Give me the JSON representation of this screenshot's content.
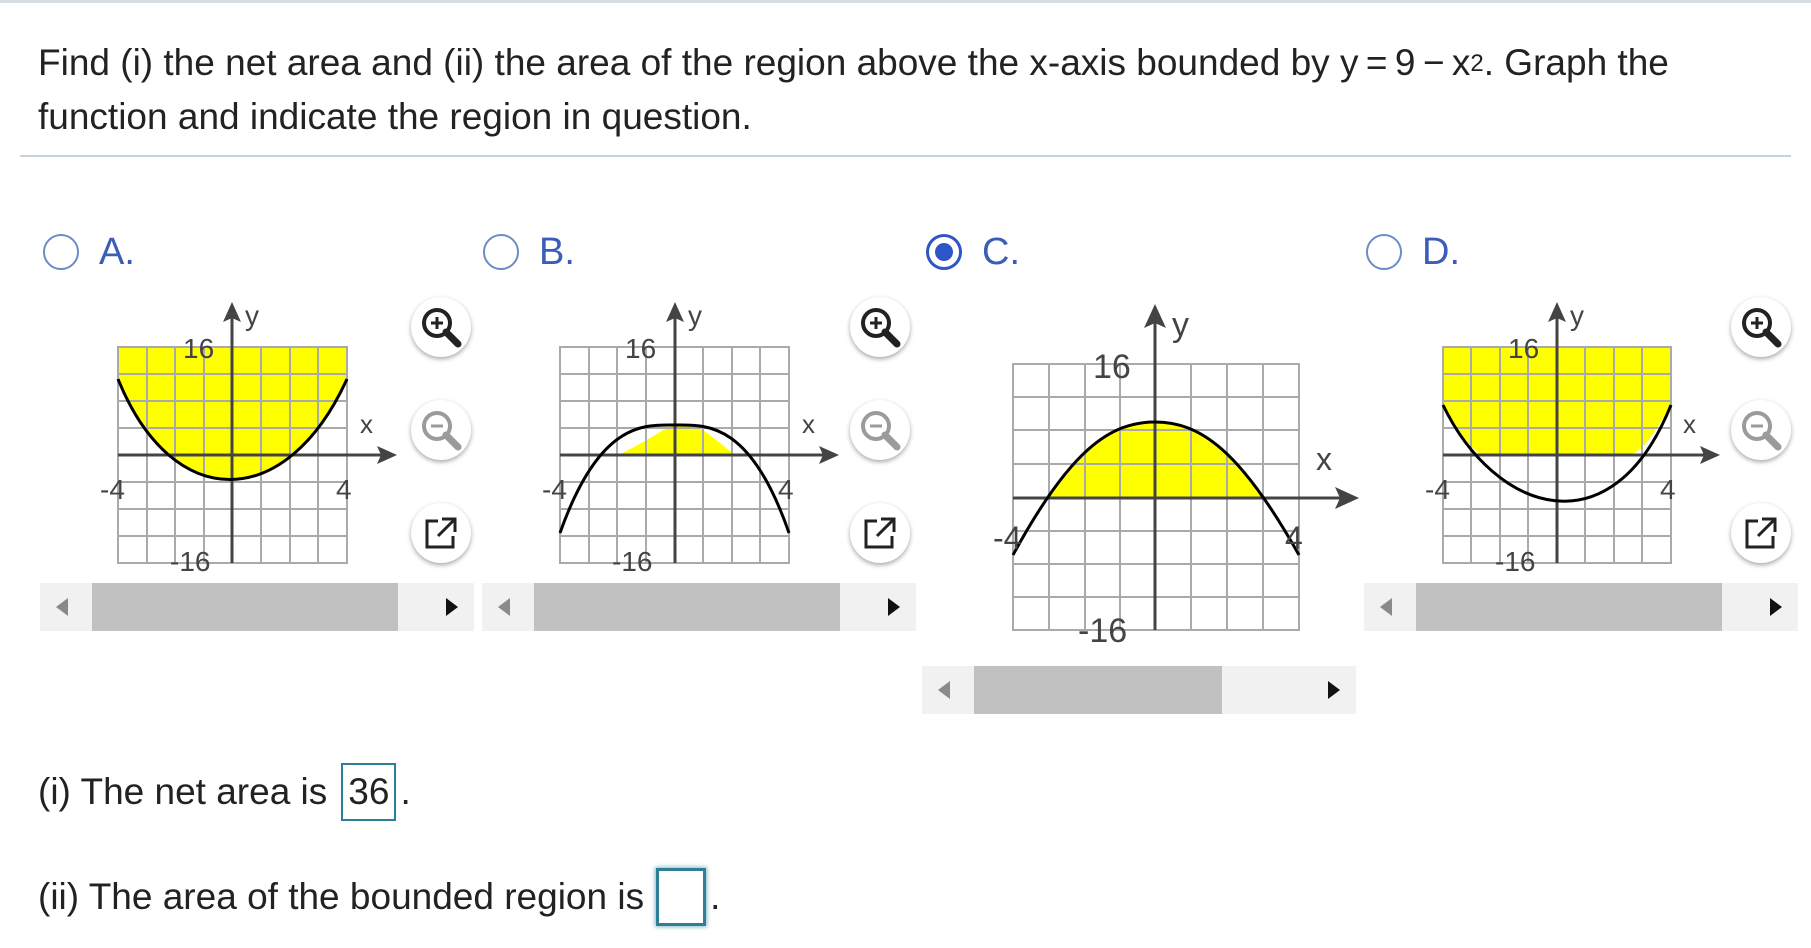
{
  "question": {
    "text_before": "Find (i) the net area and (ii) the area of the region above the x-axis bounded by y = 9 − x",
    "superscript": "2",
    "text_after": ". Graph the function and indicate the region in question."
  },
  "options": [
    {
      "letter": "A.",
      "selected": false,
      "tick_top": "16",
      "tick_bottom": "-16",
      "tick_left": "-4",
      "tick_right": "4",
      "x_label": "x",
      "y_label": "y",
      "curve": "9 + x^2 (opens up)",
      "shaded": "above curve to top of grid"
    },
    {
      "letter": "B.",
      "selected": false,
      "tick_top": "16",
      "tick_bottom": "-16",
      "tick_left": "-4",
      "tick_right": "4",
      "x_label": "x",
      "y_label": "y",
      "curve": "9 - x^2 on axis at 16-row grid, x-axis near top",
      "shaded": "above y = 0 under curve"
    },
    {
      "letter": "C.",
      "selected": true,
      "tick_top": "16",
      "tick_bottom": "-16",
      "tick_left": "-4",
      "tick_right": "4",
      "x_label": "x",
      "y_label": "y",
      "curve": "9 - x^2",
      "shaded": "between curve and x-axis, -3 to 3"
    },
    {
      "letter": "D.",
      "selected": false,
      "tick_top": "16",
      "tick_bottom": "-16",
      "tick_left": "-4",
      "tick_right": "4",
      "x_label": "x",
      "y_label": "y",
      "curve": "x^2 - 9 (opens up)",
      "shaded": "above curve to top of grid"
    }
  ],
  "answers": {
    "net_area_label": "(i) The net area is",
    "net_area_value": "36",
    "net_area_suffix": ".",
    "bounded_area_label": "(ii) The area of the bounded region is",
    "bounded_area_value": "",
    "bounded_area_suffix": "."
  },
  "icons": [
    "zoom-in-icon",
    "zoom-out-icon",
    "popout-icon"
  ],
  "colors": {
    "shade": "#ffff00",
    "radio_accent": "#2f56c9",
    "option_letter": "#3a5db5",
    "answer_border": "#2c7f96"
  }
}
